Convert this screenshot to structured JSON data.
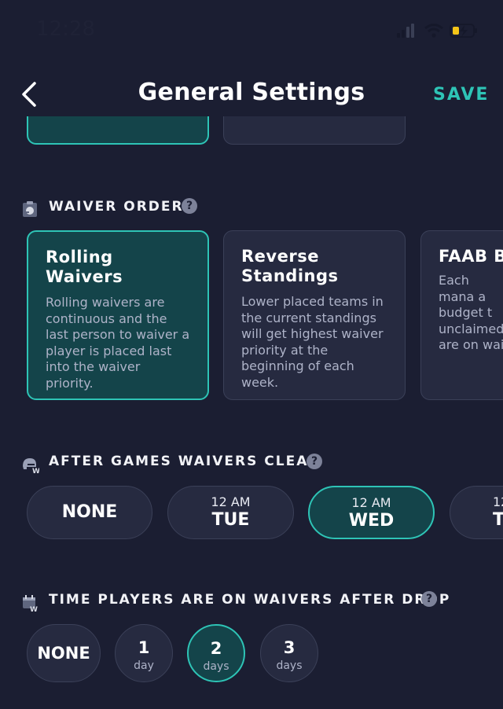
{
  "status_bar": {
    "time": "12:28"
  },
  "header": {
    "title": "General Settings",
    "save_label": "SAVE"
  },
  "waiver_order": {
    "heading": "WAIVER ORDER",
    "help": "?",
    "options": [
      {
        "title_line1": "Rolling",
        "title_line2": "Waivers",
        "description": "Rolling waivers are continuous and the last person to waiver a player is placed last into the waiver priority.",
        "selected": true
      },
      {
        "title_line1": "Reverse",
        "title_line2": "Standings",
        "description": "Lower placed teams in the current standings will get highest waiver priority at the beginning of each week.",
        "selected": false
      },
      {
        "title_line1": "FAAB B",
        "title_line2": "",
        "description": "Each mana a budget t unclaimed are on wai",
        "selected": false
      }
    ]
  },
  "after_games": {
    "heading": "AFTER GAMES WAIVERS CLEAR",
    "help": "?",
    "options": [
      {
        "time": "",
        "day": "NONE",
        "selected": false
      },
      {
        "time": "12 AM",
        "day": "TUE",
        "selected": false
      },
      {
        "time": "12 AM",
        "day": "WED",
        "selected": true
      },
      {
        "time": "12",
        "day": "T",
        "selected": false
      }
    ]
  },
  "time_on_waivers": {
    "heading": "TIME PLAYERS ARE ON WAIVERS AFTER DROP",
    "help": "?",
    "options": [
      {
        "value": "NONE",
        "unit": "",
        "selected": false
      },
      {
        "value": "1",
        "unit": "day",
        "selected": false
      },
      {
        "value": "2",
        "unit": "days",
        "selected": true
      },
      {
        "value": "3",
        "unit": "days",
        "selected": false
      }
    ]
  },
  "colors": {
    "accent": "#2ec4b6",
    "background": "#1b1e32",
    "card": "#262a40",
    "selected_card": "#14444a"
  }
}
